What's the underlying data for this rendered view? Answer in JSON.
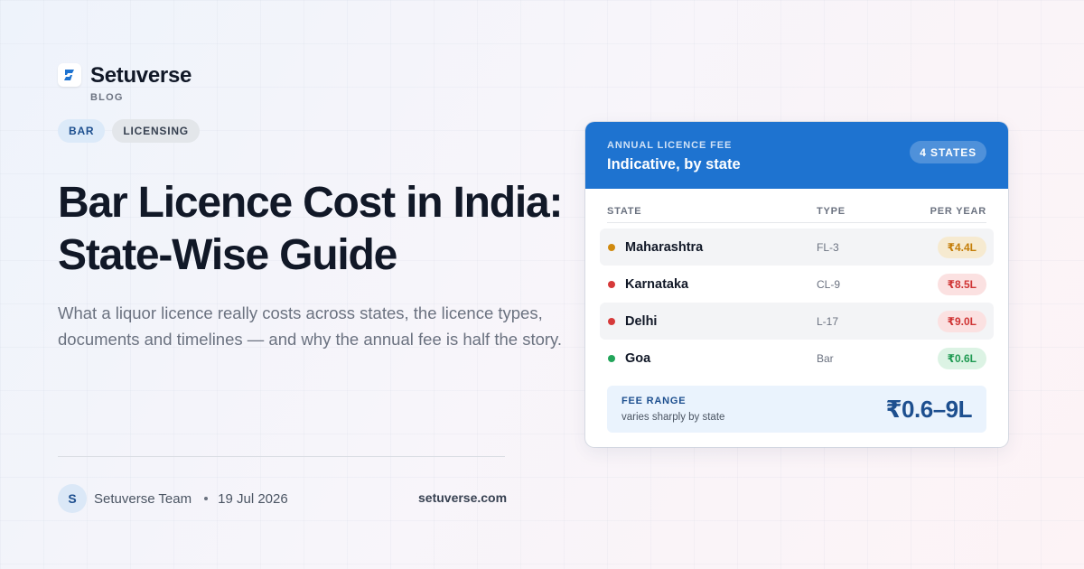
{
  "brand": {
    "name": "Setuverse",
    "sub": "BLOG",
    "logo_icon": "s-logo-icon",
    "accent": "#1e73d0"
  },
  "tags": [
    {
      "label": "BAR"
    },
    {
      "label": "LICENSING"
    }
  ],
  "article": {
    "title": "Bar Licence Cost in India: State-Wise Guide",
    "description": "What a liquor licence really costs across states, the licence types, documents and timelines — and why the annual fee is half the story."
  },
  "author": {
    "initial": "S",
    "name": "Setuverse Team",
    "date": "19 Jul 2026"
  },
  "site": "setuverse.com",
  "card": {
    "kicker": "ANNUAL LICENCE FEE",
    "title": "Indicative, by state",
    "badge": "4 STATES",
    "columns": {
      "state": "STATE",
      "type": "TYPE",
      "per_year": "PER YEAR"
    },
    "rows": [
      {
        "state": "Maharashtra",
        "type": "FL-3",
        "fee": "₹4.4L",
        "dot_color": "#d08a0e",
        "pill_bg": "#f6ead0",
        "pill_fg": "#c47d08"
      },
      {
        "state": "Karnataka",
        "type": "CL-9",
        "fee": "₹8.5L",
        "dot_color": "#d63a3a",
        "pill_bg": "#fbe1e1",
        "pill_fg": "#cf3434"
      },
      {
        "state": "Delhi",
        "type": "L-17",
        "fee": "₹9.0L",
        "dot_color": "#d63a3a",
        "pill_bg": "#fbe1e1",
        "pill_fg": "#cf3434"
      },
      {
        "state": "Goa",
        "type": "Bar",
        "fee": "₹0.6L",
        "dot_color": "#22a55a",
        "pill_bg": "#dcf3e4",
        "pill_fg": "#1f9a52"
      }
    ],
    "fee_range": {
      "label": "FEE RANGE",
      "sub": "varies sharply by state",
      "value": "₹0.6–9L"
    }
  }
}
